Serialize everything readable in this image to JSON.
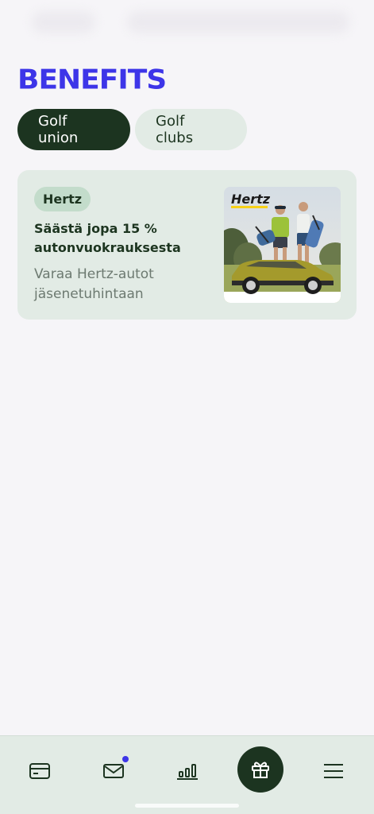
{
  "page": {
    "title": "BENEFITS"
  },
  "tabs": [
    {
      "label": "Golf union",
      "active": true
    },
    {
      "label": "Golf clubs",
      "active": false
    }
  ],
  "benefits": [
    {
      "badge": "Hertz",
      "title": "Säästä jopa 15 % autonvuokrauksesta",
      "subtitle": "Varaa Hertz-autot jäsenetuhintaan",
      "image_logo": "Hertz"
    }
  ],
  "nav": {
    "items": [
      {
        "icon": "card-icon"
      },
      {
        "icon": "mail-icon",
        "has_notification": true
      },
      {
        "icon": "stats-icon"
      },
      {
        "icon": "gift-icon",
        "active": true
      },
      {
        "icon": "menu-icon"
      }
    ]
  },
  "colors": {
    "accent": "#3d35e8",
    "dark_green": "#1c3420",
    "light_green": "#e2ebe5",
    "badge_green": "#c3dccb",
    "hertz_yellow": "#f7d117"
  }
}
